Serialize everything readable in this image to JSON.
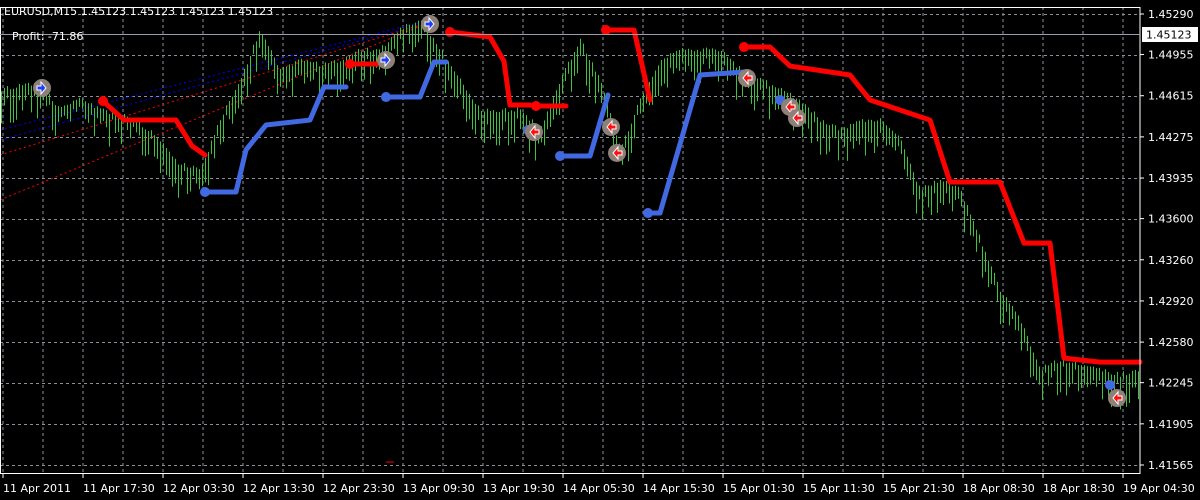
{
  "header": {
    "symbol": "EURUSD,M15",
    "ohlc": "1.45123 1.45123 1.45123 1.45123",
    "profit": "Profit: -71.86"
  },
  "colors": {
    "background": "#000000",
    "grid": "#8a8f99",
    "bars": "#3cc43c",
    "sell_stop": "#ff0000",
    "buy_stop": "#4169e1",
    "marker": "#8c8078",
    "axis": "#ffffff"
  },
  "chart_data": {
    "type": "bar",
    "title": "EURUSD,M15",
    "x_unit": "bar index (each index = 20 chart columns)",
    "ylim": [
      1.41565,
      1.4529
    ],
    "current_price": "1.45123",
    "y_ticks": [
      "1.45290",
      "1.44955",
      "1.44615",
      "1.44275",
      "1.43935",
      "1.43600",
      "1.43260",
      "1.42920",
      "1.42580",
      "1.42245",
      "1.41905",
      "1.41565"
    ],
    "x_ticks": [
      "11 Apr 2011",
      "11 Apr 17:30",
      "12 Apr 03:30",
      "12 Apr 13:30",
      "12 Apr 23:30",
      "13 Apr 09:30",
      "13 Apr 19:30",
      "14 Apr 05:30",
      "14 Apr 15:30",
      "15 Apr 01:30",
      "15 Apr 11:30",
      "15 Apr 21:30",
      "18 Apr 08:30",
      "18 Apr 18:30",
      "19 Apr 04:30"
    ],
    "grid": true,
    "price_series": [
      1.4458,
      1.44621,
      1.44621,
      1.44414,
      1.44497,
      1.44414,
      1.44373,
      1.44291,
      1.44167,
      1.4396,
      1.43919,
      1.44332,
      1.44662,
      1.45075,
      1.44745,
      1.44827,
      1.44786,
      1.44827,
      1.4491,
      1.4491,
      1.45075,
      1.45158,
      1.4491,
      1.44662,
      1.44414,
      1.44414,
      1.44414,
      1.44249,
      1.44662,
      1.44993,
      1.44662,
      1.44084,
      1.44497,
      1.44827,
      1.4491,
      1.4491,
      1.4491,
      1.44745,
      1.44662,
      1.4458,
      1.44497,
      1.44332,
      1.44249,
      1.44332,
      1.44332,
      1.44167,
      1.43754,
      1.43836,
      1.43754,
      1.43341,
      1.42928,
      1.4268,
      1.42267,
      1.42349,
      1.42308,
      1.42267,
      1.42226,
      1.42267
    ],
    "series": [
      {
        "name": "sell-stop",
        "segments": [
          [
            [
              5.15,
              1.44571
            ],
            [
              6.2,
              1.44414
            ],
            [
              8.8,
              1.44414
            ],
            [
              9.6,
              1.442
            ],
            [
              10.25,
              1.44125
            ]
          ],
          [
            [
              17.5,
              1.44877
            ],
            [
              19.5,
              1.44877
            ]
          ],
          [
            [
              22.5,
              1.45141
            ],
            [
              24.5,
              1.451
            ],
            [
              25.2,
              1.449
            ],
            [
              25.5,
              1.44538
            ],
            [
              26.5,
              1.44538
            ]
          ],
          [
            [
              26.8,
              1.4453
            ],
            [
              28.3,
              1.4453
            ]
          ],
          [
            [
              30.3,
              1.45158
            ],
            [
              31.7,
              1.45158
            ],
            [
              32.5,
              1.4458
            ]
          ],
          [
            [
              37.2,
              1.45017
            ],
            [
              38.5,
              1.45017
            ],
            [
              39.5,
              1.4486
            ],
            [
              42.5,
              1.44786
            ],
            [
              43.5,
              1.4458
            ],
            [
              46.5,
              1.44414
            ],
            [
              47.5,
              1.43902
            ],
            [
              50,
              1.43902
            ],
            [
              51.2,
              1.43398
            ],
            [
              52.5,
              1.43398
            ],
            [
              53.2,
              1.42448
            ],
            [
              55,
              1.42415
            ],
            [
              57,
              1.42415
            ]
          ]
        ]
      },
      {
        "name": "buy-stop",
        "segments": [
          [
            [
              10.25,
              1.4382
            ],
            [
              11.8,
              1.4382
            ],
            [
              12.3,
              1.44167
            ],
            [
              13.3,
              1.44373
            ],
            [
              15.5,
              1.44414
            ],
            [
              16.2,
              1.44687
            ],
            [
              17.3,
              1.44687
            ]
          ],
          [
            [
              19.3,
              1.44604
            ],
            [
              21,
              1.44604
            ],
            [
              21.7,
              1.44894
            ],
            [
              22.3,
              1.44894
            ]
          ],
          [
            [
              26.4,
              1.44332
            ],
            [
              26.8,
              1.44332
            ]
          ],
          [
            [
              28,
              1.44117
            ],
            [
              29.5,
              1.44117
            ],
            [
              30.4,
              1.44621
            ]
          ],
          [
            [
              32.4,
              1.43646
            ],
            [
              33,
              1.43646
            ],
            [
              35,
              1.44786
            ],
            [
              37.2,
              1.44811
            ]
          ],
          [
            [
              39,
              1.4458
            ],
            [
              39.5,
              1.445
            ]
          ],
          [
            [
              55.5,
              1.42226
            ],
            [
              55.6,
              1.42226
            ]
          ]
        ]
      }
    ],
    "trade_markers": [
      {
        "x": 2.1,
        "price": 1.44679,
        "side": "buy"
      },
      {
        "x": 19.3,
        "price": 1.4491,
        "side": "buy"
      },
      {
        "x": 21.5,
        "price": 1.45207,
        "side": "buy"
      },
      {
        "x": 26.7,
        "price": 1.44315,
        "side": "sell"
      },
      {
        "x": 30.55,
        "price": 1.44357,
        "side": "sell"
      },
      {
        "x": 30.85,
        "price": 1.44142,
        "side": "sell"
      },
      {
        "x": 37.35,
        "price": 1.44761,
        "side": "sell"
      },
      {
        "x": 39.5,
        "price": 1.44522,
        "side": "sell"
      },
      {
        "x": 39.85,
        "price": 1.44431,
        "side": "sell"
      },
      {
        "x": 55.85,
        "price": 1.42118,
        "side": "sell"
      }
    ]
  }
}
